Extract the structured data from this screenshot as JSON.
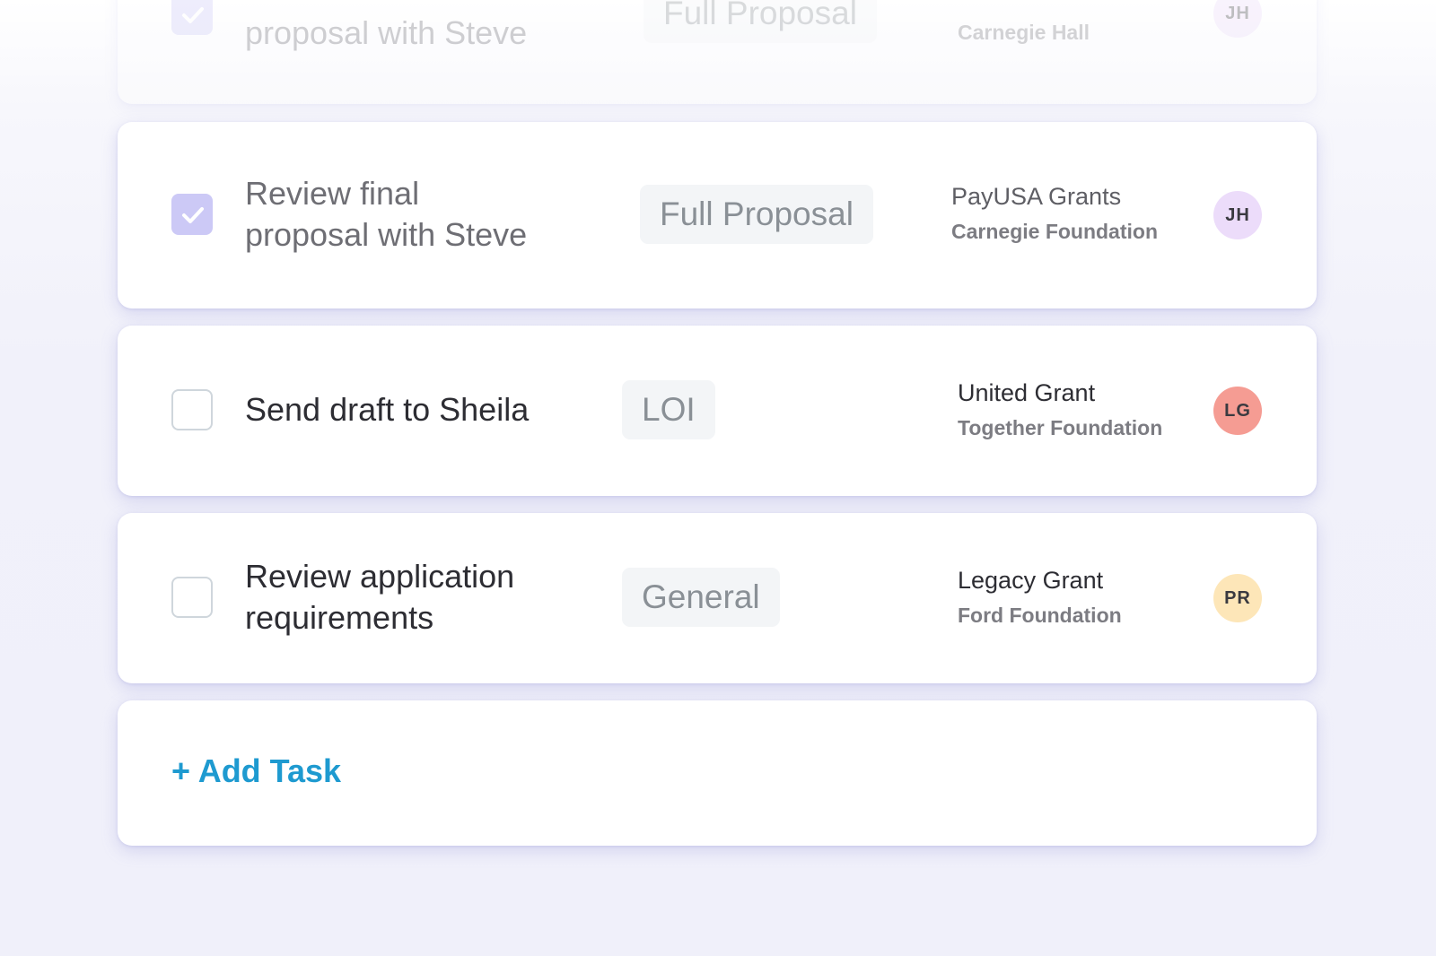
{
  "colors": {
    "accent": "#1e9ad0",
    "checked_checkbox": "#ccc9f6",
    "avatar_jh": "#ecdcfa",
    "avatar_lg": "#f59c93",
    "avatar_pr": "#fde6b8"
  },
  "tasks": [
    {
      "title": "proposal with Steve",
      "tag": "Full Proposal",
      "grant_org": "Carnegie Hall",
      "assignee": "JH",
      "checked": true
    },
    {
      "title_line1": "Review final",
      "title_line2": "proposal with Steve",
      "tag": "Full Proposal",
      "grant_name": "PayUSA Grants",
      "grant_org": "Carnegie Foundation",
      "assignee": "JH",
      "checked": true
    },
    {
      "title": "Send draft to Sheila",
      "tag": "LOI",
      "grant_name": "United Grant",
      "grant_org": "Together Foundation",
      "assignee": "LG",
      "checked": false
    },
    {
      "title_line1": "Review application",
      "title_line2": "requirements",
      "tag": "General",
      "grant_name": "Legacy Grant",
      "grant_org": "Ford Foundation",
      "assignee": "PR",
      "checked": false
    }
  ],
  "add_task": {
    "label": "+ Add Task"
  }
}
